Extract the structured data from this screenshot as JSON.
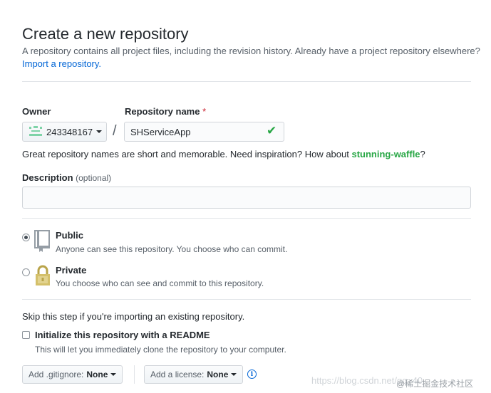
{
  "header": {
    "title": "Create a new repository",
    "subtitle": "A repository contains all project files, including the revision history. Already have a project repository elsewhere?",
    "import_link": "Import a repository."
  },
  "owner": {
    "label": "Owner",
    "value": "243348167",
    "avatar_icon": "identicon-avatar",
    "accent": "#7fd3a8"
  },
  "separator": "/",
  "repo_name": {
    "label": "Repository name",
    "required_mark": "*",
    "value": "SHServiceApp",
    "valid_icon": "check-icon"
  },
  "hint": {
    "text": "Great repository names are short and memorable. Need inspiration? How about",
    "suggestion": "stunning-waffle",
    "end": "?"
  },
  "description": {
    "label": "Description",
    "optional": "(optional)",
    "value": ""
  },
  "visibility": {
    "options": [
      {
        "title": "Public",
        "note": "Anyone can see this repository. You choose who can commit.",
        "icon": "repo-book-icon",
        "selected": true
      },
      {
        "title": "Private",
        "note": "You choose who can see and commit to this repository.",
        "icon": "lock-icon",
        "selected": false
      }
    ]
  },
  "skip_note": "Skip this step if you're importing an existing repository.",
  "readme": {
    "label": "Initialize this repository with a README",
    "note": "This will let you immediately clone the repository to your computer.",
    "checked": false
  },
  "gitignore": {
    "label": "Add .gitignore:",
    "value": "None"
  },
  "license": {
    "label": "Add a license:",
    "value": "None"
  },
  "info_icon": "info-icon",
  "watermark": {
    "url": "https://blog.csdn.net/qq_40",
    "community": "@稀土掘金技术社区"
  },
  "colors": {
    "link": "#0366d6",
    "success": "#28a745",
    "required": "#cb2431"
  }
}
